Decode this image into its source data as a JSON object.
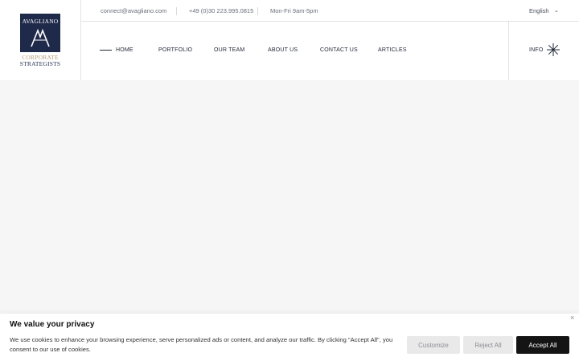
{
  "logo": {
    "name": "AVAGLIANO",
    "line1": "CORPORATE",
    "line2": "STRATEGISTS"
  },
  "topbar": {
    "email": "connect@avagliano.com",
    "phone": "+49 (0)30 223.995.0815",
    "hours": "Mon-Fri 9am-5pm",
    "language": "English",
    "language_caret": "⌄"
  },
  "nav": {
    "items": [
      {
        "label": "HOME"
      },
      {
        "label": "PORTFOLIO"
      },
      {
        "label": "OUR TEAM"
      },
      {
        "label": "ABOUT US"
      },
      {
        "label": "CONTACT US"
      },
      {
        "label": "ARTICLES"
      }
    ],
    "info": "INFO"
  },
  "cookie": {
    "title": "We value your privacy",
    "text": "We use cookies to enhance your browsing experience, serve personalized ads or content, and analyze our traffic. By clicking \"Accept All\", you consent to our use of cookies.",
    "close": "×",
    "customize": "Customize",
    "reject": "Reject All",
    "accept": "Accept All"
  },
  "colors": {
    "brand_navy": "#1f2a4b",
    "brand_gold": "#b29a76",
    "page_bg": "#f7f6f7",
    "accept_bg": "#141414"
  }
}
